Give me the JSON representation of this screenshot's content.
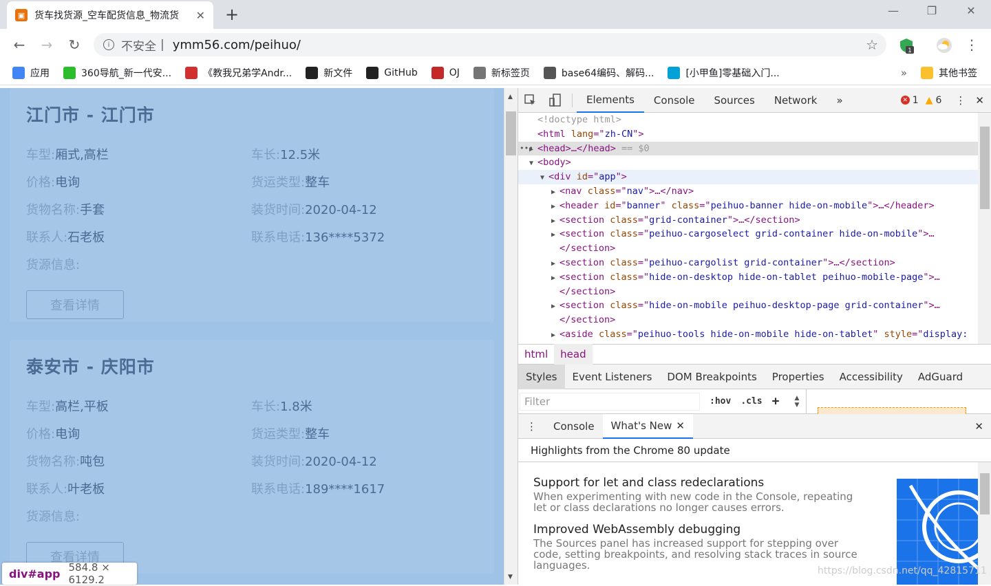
{
  "browser": {
    "tab_title": "货车找货源_空车配货信息_物流货",
    "url_security": "不安全",
    "url": "ymm56.com/peihuo/",
    "ext_badge": "1",
    "bookmarks": [
      {
        "label": "应用",
        "icon": "apps-grid-icon",
        "color": "#4285f4"
      },
      {
        "label": "360导航_新一代安...",
        "icon": "360-logo-icon",
        "color": "#2bbd2b"
      },
      {
        "label": "《教我兄弟学Andr...",
        "icon": "stamp-icon",
        "color": "#d32f2f"
      },
      {
        "label": "新文件",
        "icon": "github-icon",
        "color": "#222222"
      },
      {
        "label": "GitHub",
        "icon": "github-icon",
        "color": "#222222"
      },
      {
        "label": "OJ",
        "icon": "oj-icon",
        "color": "#c62828"
      },
      {
        "label": "新标签页",
        "icon": "globe-icon",
        "color": "#757575"
      },
      {
        "label": "base64编码、解码...",
        "icon": "tool-icon",
        "color": "#555555"
      },
      {
        "label": "[小甲鱼]零基础入门...",
        "icon": "bilibili-icon",
        "color": "#00a1d6"
      }
    ],
    "other_bookmarks": "其他书签"
  },
  "page": {
    "cards": [
      {
        "route": "江门市 - 江门市",
        "fields": [
          {
            "k": "车型:",
            "v": "厢式,高栏"
          },
          {
            "k": "车长:",
            "v": "12.5米"
          },
          {
            "k": "价格:",
            "v": "电询"
          },
          {
            "k": "货运类型:",
            "v": "整车"
          },
          {
            "k": "货物名称:",
            "v": "手套"
          },
          {
            "k": "装货时间:",
            "v": "2020-04-12"
          },
          {
            "k": "联系人:",
            "v": "石老板"
          },
          {
            "k": "联系电话:",
            "v": "136****5372"
          }
        ],
        "info_label": "货源信息:",
        "button": "查看详情"
      },
      {
        "route": "泰安市 - 庆阳市",
        "fields": [
          {
            "k": "车型:",
            "v": "高栏,平板"
          },
          {
            "k": "车长:",
            "v": "1.8米"
          },
          {
            "k": "价格:",
            "v": "电询"
          },
          {
            "k": "货运类型:",
            "v": "整车"
          },
          {
            "k": "货物名称:",
            "v": "吨包"
          },
          {
            "k": "装货时间:",
            "v": "2020-04-12"
          },
          {
            "k": "联系人:",
            "v": "叶老板"
          },
          {
            "k": "联系电话:",
            "v": "189****1617"
          }
        ],
        "info_label": "货源信息:",
        "button": "查看详情"
      }
    ],
    "tooltip": {
      "node": "div#app",
      "dims": "584.8 × 6129.2"
    }
  },
  "devtools": {
    "tabs": [
      "Elements",
      "Console",
      "Sources",
      "Network"
    ],
    "errors": "1",
    "warnings": "6",
    "dom_lines": [
      {
        "indent": 0,
        "html": "<span class='c'>&lt;!doctype html&gt;</span>"
      },
      {
        "indent": 0,
        "html": "&lt;html <span class='a'>lang</span>=\"<span class='v'>zh-CN</span>\"&gt;"
      },
      {
        "indent": 0,
        "arrow": "▶",
        "sel": true,
        "html": "&lt;head&gt;…&lt;/head&gt; <span class='c'>== $0</span>"
      },
      {
        "indent": 0,
        "arrow": "▼",
        "html": "&lt;body&gt;"
      },
      {
        "indent": 1,
        "arrow": "▼",
        "hov": true,
        "html": "&lt;div <span class='a'>id</span>=\"<span class='v'>app</span>\"&gt;"
      },
      {
        "indent": 2,
        "arrow": "▶",
        "html": "&lt;nav <span class='a'>class</span>=\"<span class='v'>nav</span>\"&gt;…&lt;/nav&gt;"
      },
      {
        "indent": 2,
        "arrow": "▶",
        "html": "&lt;header <span class='a'>id</span>=\"<span class='v'>banner</span>\" <span class='a'>class</span>=\"<span class='v'>peihuo-banner hide-on-mobile</span>\"&gt;…&lt;/header&gt;"
      },
      {
        "indent": 2,
        "arrow": "▶",
        "html": "&lt;section <span class='a'>class</span>=\"<span class='v'>grid-container</span>\"&gt;…&lt;/section&gt;"
      },
      {
        "indent": 2,
        "arrow": "▶",
        "html": "&lt;section <span class='a'>class</span>=\"<span class='v'>peihuo-cargoselect grid-container hide-on-mobile</span>\"&gt;…"
      },
      {
        "indent": 2,
        "html": "&lt;/section&gt;"
      },
      {
        "indent": 2,
        "arrow": "▶",
        "html": "&lt;section <span class='a'>class</span>=\"<span class='v'>peihuo-cargolist grid-container</span>\"&gt;…&lt;/section&gt;"
      },
      {
        "indent": 2,
        "arrow": "▶",
        "html": "&lt;section <span class='a'>class</span>=\"<span class='v'>hide-on-desktop hide-on-tablet peihuo-mobile-page</span>\"&gt;…"
      },
      {
        "indent": 2,
        "html": "&lt;/section&gt;"
      },
      {
        "indent": 2,
        "arrow": "▶",
        "html": "&lt;section <span class='a'>class</span>=\"<span class='v'>hide-on-mobile peihuo-desktop-page grid-container</span>\"&gt;…"
      },
      {
        "indent": 2,
        "html": "&lt;/section&gt;"
      },
      {
        "indent": 2,
        "arrow": "▶",
        "html": "&lt;aside <span class='a'>class</span>=\"<span class='v'>peihuo-tools hide-on-mobile hide-on-tablet</span>\" <span class='a'>style</span>=\"<span class='v'>display:</span>"
      }
    ],
    "breadcrumbs": [
      "html",
      "head"
    ],
    "styles_tabs": [
      "Styles",
      "Event Listeners",
      "DOM Breakpoints",
      "Properties",
      "Accessibility",
      "AdGuard"
    ],
    "filter_placeholder": "Filter",
    "hov": ":hov",
    "cls": ".cls",
    "drawer_tabs": [
      "Console",
      "What's New"
    ],
    "highlights": "Highlights from the Chrome 80 update",
    "news": [
      {
        "title": "Support for let and class redeclarations",
        "body": "When experimenting with new code in the Console, repeating let or class declarations no longer causes errors."
      },
      {
        "title": "Improved WebAssembly debugging",
        "body": "The Sources panel has increased support for stepping over code, setting breakpoints, and resolving stack traces in source languages."
      }
    ]
  },
  "watermark": "https://blog.csdn.net/qq_42815711"
}
